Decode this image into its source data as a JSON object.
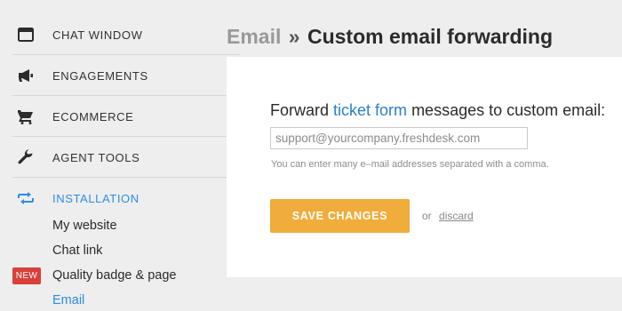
{
  "sidebar": {
    "items": [
      {
        "label": "CHAT WINDOW",
        "icon": "chat-window-icon"
      },
      {
        "label": "ENGAGEMENTS",
        "icon": "megaphone-icon"
      },
      {
        "label": "ECOMMERCE",
        "icon": "cart-icon"
      },
      {
        "label": "AGENT TOOLS",
        "icon": "wrench-icon"
      },
      {
        "label": "INSTALLATION",
        "icon": "transfer-arrows-icon",
        "active": true
      }
    ],
    "subitems": [
      {
        "label": "My website"
      },
      {
        "label": "Chat link"
      },
      {
        "label": "Quality badge & page",
        "badge": "NEW"
      },
      {
        "label": "Email",
        "current": true
      }
    ]
  },
  "header": {
    "breadcrumb_link": "Email",
    "separator": "»",
    "title": "Custom email forwarding"
  },
  "form": {
    "text_before": "Forward",
    "link_text": "ticket form",
    "text_after": "messages to custom email:",
    "input_value": "",
    "input_placeholder": "support@yourcompany.freshdesk.com",
    "hint": "You can enter many e–mail addresses separated with a comma.",
    "save_label": "SAVE CHANGES",
    "or_text": "or",
    "discard_label": "discard"
  },
  "colors": {
    "accent_blue": "#2d8ce6",
    "link_blue": "#2d7fc7",
    "save_orange": "#f0ad3c",
    "badge_red": "#d9403a",
    "background": "#eeeeee"
  }
}
